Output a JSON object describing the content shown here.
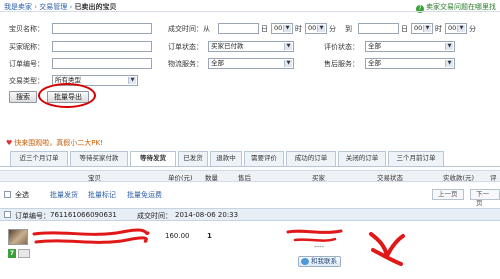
{
  "breadcrumb": {
    "item1": "我是卖家",
    "sep1": "›",
    "item2": "交易管理",
    "sep2": "›",
    "current": "已卖出的宝贝"
  },
  "help_link": "卖家交易问题在哪里找",
  "filters": {
    "item_name_label": "宝贝名称：",
    "deal_time_label": "成交时间：从",
    "day_unit": "日",
    "hour_value": "00",
    "hour_unit": "时",
    "minute_value": "00",
    "minute_unit": "分",
    "to_label": "到",
    "buyer_label": "买家昵称：",
    "order_status_label": "订单状态：",
    "order_status_value": "买家已付款",
    "rating_status_label": "评价状态：",
    "rating_status_value": "全部",
    "order_no_label": "订单编号：",
    "logistics_label": "物流服务：",
    "logistics_value": "全部",
    "aftersale_label": "售后服务：",
    "aftersale_value": "全部",
    "trade_type_label": "交易类型：",
    "trade_type_value": "所有类型"
  },
  "buttons": {
    "search": "搜索",
    "batch_export": "批量导出"
  },
  "banner": "快来围观啦，真假小二大PK!",
  "tabs": [
    "近三个月订单",
    "等待买家付款",
    "等待发货",
    "已发货",
    "退款中",
    "需要评价",
    "成功的订单",
    "关闭的订单",
    "三个月前订单"
  ],
  "active_tab": "等待发货",
  "columns": {
    "item": "宝贝",
    "price": "单价(元)",
    "qty": "数量",
    "aftersale": "售后",
    "buyer": "买家",
    "status": "交易状态",
    "paid": "实收款(元)",
    "rating": "评"
  },
  "batch": {
    "select_all": "全选",
    "ship": "批量发货",
    "mark": "批量标记",
    "free_shipping": "批量免运费",
    "prev_page": "上一页",
    "next_page": "下一页"
  },
  "order": {
    "no_label": "订单编号：",
    "no_value": "761161066090631",
    "time_label": "成交时间：",
    "time_value": "2014-08-06 20:33",
    "price": "160.00",
    "qty": "1",
    "buyer_extra": "----",
    "contact": "和我联系",
    "badge": "7"
  },
  "colors": {
    "annotation_red": "#d60000",
    "link_blue": "#2b5ea8"
  }
}
